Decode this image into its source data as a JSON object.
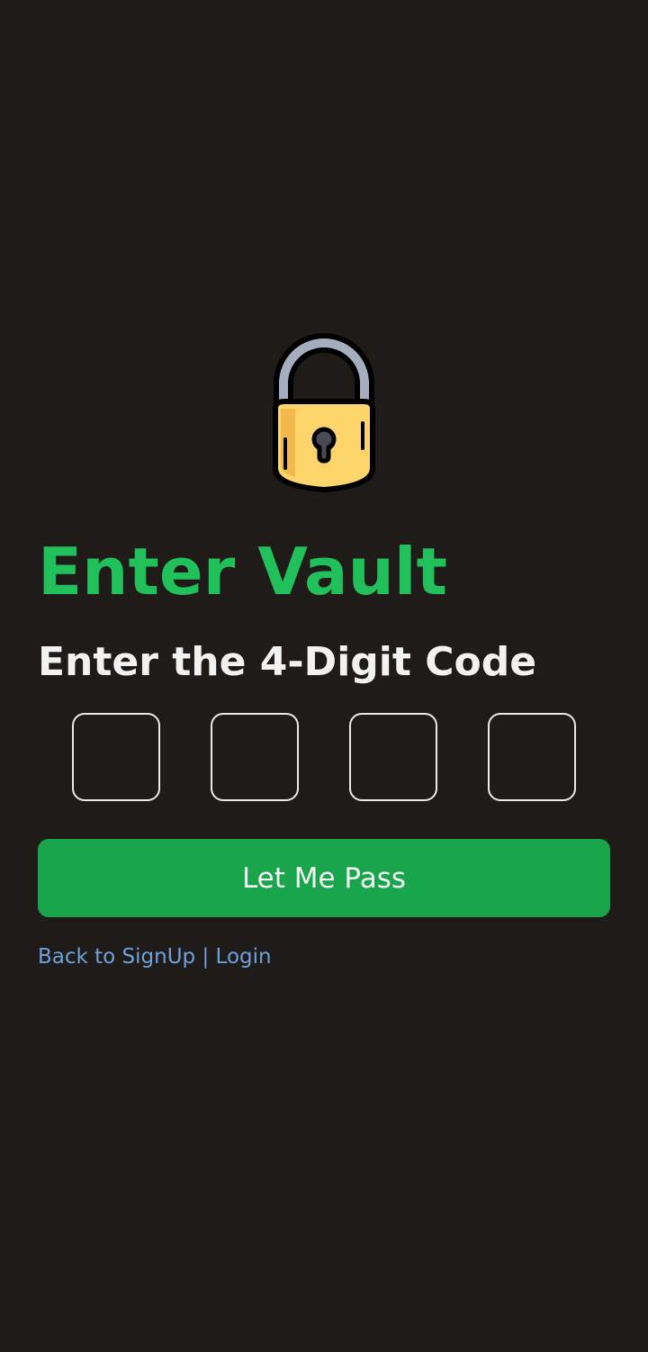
{
  "vault": {
    "title": "Enter Vault",
    "subtitle": "Enter the 4-Digit Code",
    "code_digits": [
      "",
      "",
      "",
      ""
    ],
    "submit_label": "Let Me Pass",
    "back_signup_label": "Back to SignUp",
    "separator": " | ",
    "login_label": "Login"
  },
  "icons": {
    "hero": "padlock-icon"
  },
  "colors": {
    "background": "#1e1b18",
    "title": "#22c05a",
    "subtitle": "#f2f2f2",
    "button": "#18a54c",
    "button_text": "#f4f4f4",
    "link": "#6ea0dc",
    "code_box_border": "#e9e9e9",
    "lock_body": "#fdd56b",
    "lock_shackle": "#a6adbf"
  }
}
